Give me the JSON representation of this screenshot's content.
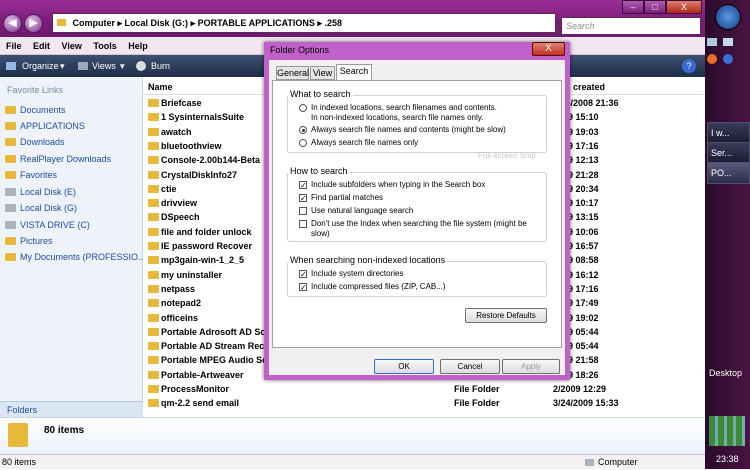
{
  "window": {
    "address": [
      "Computer",
      "Local Disk (G:)",
      "PORTABLE APPLICATIONS",
      ".258"
    ],
    "search_placeholder": "Search"
  },
  "menu": [
    "File",
    "Edit",
    "View",
    "Tools",
    "Help"
  ],
  "toolbar": {
    "organize": "Organize",
    "views": "Views",
    "burn": "Burn"
  },
  "left_pane": {
    "header": "Favorite Links",
    "items": [
      "Documents",
      "APPLICATIONS",
      "Downloads",
      "RealPlayer Downloads",
      "Favorites",
      "Local Disk (E)",
      "Local Disk (G)",
      "VISTA DRIVE (C)",
      "Pictures",
      "My Documents (PROFESSIO..."
    ],
    "folders_label": "Folders"
  },
  "file_list": {
    "name_header": "Name",
    "date_header": "created",
    "rows": [
      {
        "name": "Briefcase",
        "type": "",
        "date": "3/24/2008 21:36"
      },
      {
        "name": "1 SysinternalsSuite",
        "type": "",
        "date": "2009 15:10"
      },
      {
        "name": "awatch",
        "type": "",
        "date": "2009 19:03"
      },
      {
        "name": "bluetoothview",
        "type": "",
        "date": "2009 17:16"
      },
      {
        "name": "Console-2.00b144-Beta",
        "type": "",
        "date": "2009 12:13"
      },
      {
        "name": "CrystalDiskInfo27",
        "type": "",
        "date": "2009 21:28"
      },
      {
        "name": "ctie",
        "type": "",
        "date": "2009 20:34"
      },
      {
        "name": "drivview",
        "type": "",
        "date": "2009 10:17"
      },
      {
        "name": "DSpeech",
        "type": "",
        "date": "2009 13:15"
      },
      {
        "name": "file and folder unlock",
        "type": "",
        "date": "2009 10:06"
      },
      {
        "name": "IE password Recover",
        "type": "",
        "date": "2009 16:57"
      },
      {
        "name": "mp3gain-win-1_2_5",
        "type": "",
        "date": "2009 08:58"
      },
      {
        "name": "my uninstaller",
        "type": "",
        "date": "2009 16:12"
      },
      {
        "name": "netpass",
        "type": "",
        "date": "2009 17:16"
      },
      {
        "name": "notepad2",
        "type": "",
        "date": "2009 17:49"
      },
      {
        "name": "officeins",
        "type": "",
        "date": "2009 19:02"
      },
      {
        "name": "Portable  Adrosoft AD Sc",
        "type": "",
        "date": "2009 05:44"
      },
      {
        "name": "Portable AD Stream Reco",
        "type": "",
        "date": "2009 05:44"
      },
      {
        "name": "Portable MPEG Audio Scis",
        "type": "",
        "date": "2009 21:58"
      },
      {
        "name": "Portable-Artweaver",
        "type": "",
        "date": "2009 18:26"
      },
      {
        "name": "ProcessMonitor",
        "type": "File Folder",
        "date": "2/2009 12:29"
      },
      {
        "name": "qm-2.2 send email",
        "type": "File Folder",
        "date": "3/24/2009 15:33"
      }
    ]
  },
  "details": {
    "count": "80 items"
  },
  "status": {
    "items": "80 items",
    "location": "Computer"
  },
  "sidebar": {
    "tiles": [
      "I w...",
      "Ser...",
      "PO..."
    ],
    "desktop": "Desktop",
    "clock": "23:38"
  },
  "dialog": {
    "title": "Folder Options",
    "close": "X",
    "tabs": [
      "General",
      "View",
      "Search"
    ],
    "group1": {
      "label": "What to search",
      "opt1_line1": "In indexed locations, search filenames and contents.",
      "opt1_line2": "In non-indexed locations, search file names only.",
      "opt2": "Always search file names and contents (might be slow)",
      "opt3": "Always search file names only",
      "selected": 2
    },
    "watermark": "Full-screen Snip",
    "group2": {
      "label": "How to search",
      "opt1": "Include subfolders when typing in the Search box",
      "opt2": "Find partial matches",
      "opt3": "Use natural language search",
      "opt4_line1": "Don't use the Index when searching the file system (might be",
      "opt4_line2": "slow)"
    },
    "group3": {
      "label": "When searching non-indexed locations",
      "opt1": "Include system directories",
      "opt2": "Include compressed files (ZIP, CAB...)"
    },
    "restore": "Restore Defaults",
    "ok": "OK",
    "cancel": "Cancel",
    "apply": "Apply"
  }
}
